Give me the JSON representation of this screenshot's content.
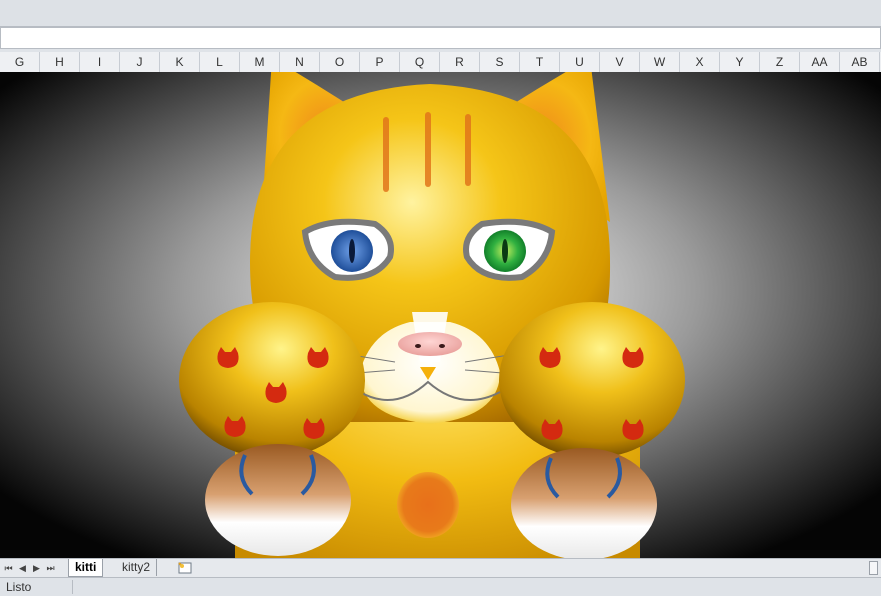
{
  "columns": [
    "G",
    "H",
    "I",
    "J",
    "K",
    "L",
    "M",
    "N",
    "O",
    "P",
    "Q",
    "R",
    "S",
    "T",
    "U",
    "V",
    "W",
    "X",
    "Y",
    "Z",
    "AA",
    "AB"
  ],
  "sheet_tabs": [
    {
      "label": "kitti",
      "active": true
    },
    {
      "label": "kitty2",
      "active": false
    }
  ],
  "status": {
    "text": "Listo"
  },
  "colors": {
    "fur": "#f2b60c",
    "fur_dark": "#d08a00",
    "stripe": "#e0761a",
    "eye_left": "#2f66b8",
    "eye_right": "#28a83c",
    "nose": "#f3b3b0",
    "belly_spot": "#e8731a",
    "paw_print": "#d42a10"
  },
  "icons": [
    "first-sheet-icon",
    "prev-sheet-icon",
    "next-sheet-icon",
    "last-sheet-icon",
    "insert-sheet-icon"
  ]
}
